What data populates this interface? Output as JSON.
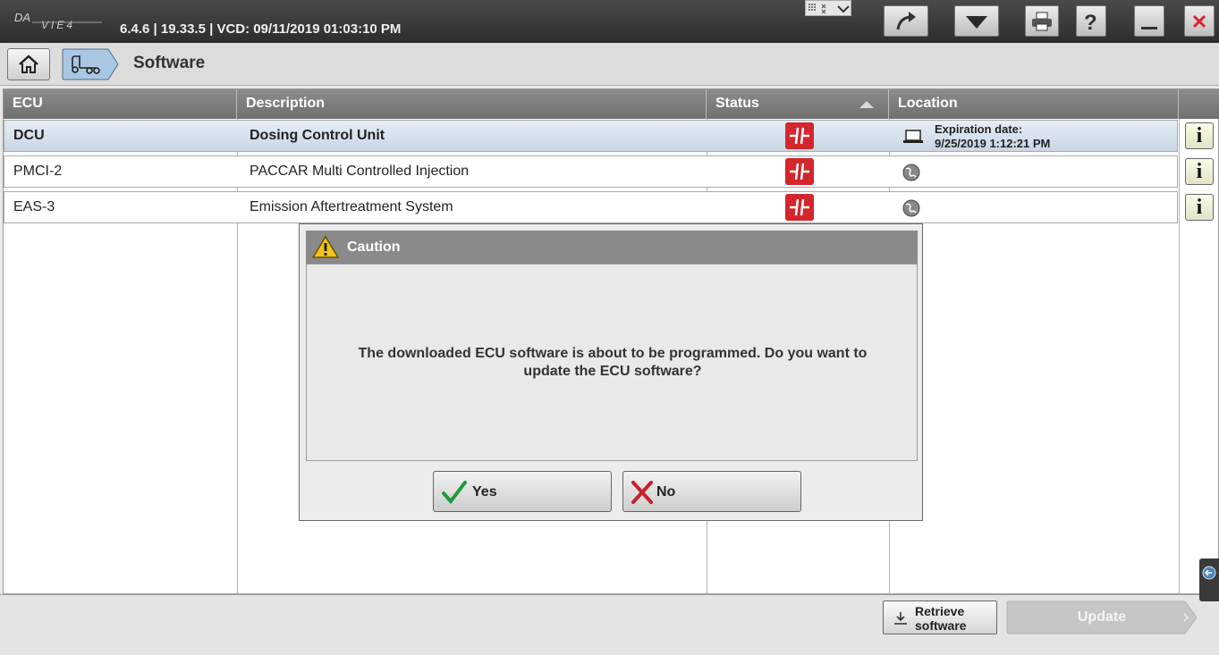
{
  "titlebar": {
    "version_info": "6.4.6 | 19.33.5 | VCD: 09/11/2019 01:03:10 PM",
    "icons": [
      "forward-arrow-icon",
      "dropdown-arrow-icon",
      "print-icon",
      "help-icon",
      "minimize-icon",
      "close-icon"
    ]
  },
  "breadcrumb": {
    "title": "Software"
  },
  "table": {
    "headers": {
      "ecu": "ECU",
      "description": "Description",
      "status": "Status",
      "location": "Location"
    },
    "rows": [
      {
        "ecu": "DCU",
        "description": "Dosing Control Unit",
        "location_label": "Expiration date:",
        "location_value": "9/25/2019 1:12:21 PM",
        "location_icon": "laptop-icon",
        "selected": true
      },
      {
        "ecu": "PMCI-2",
        "description": "PACCAR Multi Controlled Injection",
        "location_icon": "globe-icon",
        "selected": false
      },
      {
        "ecu": "EAS-3",
        "description": "Emission Aftertreatment System",
        "location_icon": "globe-icon",
        "selected": false
      }
    ],
    "info_label": "i"
  },
  "footer": {
    "retrieve_line1": "Retrieve",
    "retrieve_line2": "software",
    "update_label": "Update"
  },
  "dialog": {
    "title": "Caution",
    "message_line1": "The downloaded ECU software is about to be programmed. Do you want to",
    "message_line2": "update the ECU software?",
    "yes_label": "Yes",
    "no_label": "No"
  },
  "colors": {
    "status_red": "#d3262d",
    "header_gray": "#7c7c7c",
    "yes_green": "#1f9a3a",
    "no_red": "#c8202a"
  }
}
